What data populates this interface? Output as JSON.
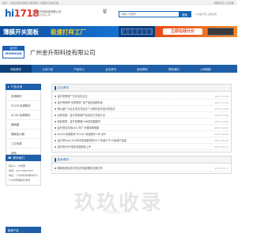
{
  "topbar": {
    "left": "您好，欢迎光临中国电子网商城 | 请登录 免费注册",
    "right": "收藏本站 | 手机版"
  },
  "logo": {
    "main": "hi",
    "accent": "1718"
  },
  "site": {
    "name": "广州金升阳科技有限公司",
    "subtitle": "找电源就到电子网"
  },
  "header_tag": "留",
  "search": {
    "placeholder": "请输入关键字",
    "button": "搜索"
  },
  "top_links": "广州金升阳  立即咨询",
  "banner": {
    "left_title": "薄膜开关面板",
    "left_highlight": "极速打样工厂",
    "cta": "立即在线计价"
  },
  "company": {
    "logo_top": "金升阳",
    "logo_bottom": "MORNSUN",
    "name": "广州金升阳科技有限公司"
  },
  "nav": [
    {
      "label": "网站首页",
      "active": true
    },
    {
      "label": "公司介绍",
      "active": false
    },
    {
      "label": "产品中心",
      "active": false
    },
    {
      "label": "企业资讯",
      "active": false
    },
    {
      "label": "技术资料",
      "active": false
    },
    {
      "label": "联系我们",
      "active": false
    },
    {
      "label": "公司相册",
      "active": false
    }
  ],
  "sidebar": {
    "title": "产品分类",
    "items": [
      "电源模块",
      "DC/DC电源模块",
      "AC/DC电源模块",
      "隔离器",
      "隔离放大器",
      "工业电源",
      "其他"
    ]
  },
  "contact": {
    "title": "联系我们",
    "lines": [
      "联系人：市场部",
      "电话：020-38601850",
      "地址：广州市科学城科学大道",
      "广州市黄埔区科学城"
    ]
  },
  "news": {
    "title": "企业资讯",
    "rows": [
      {
        "title": "金升阳荣获广东省名优企业",
        "date": "2017-11-16"
      },
      {
        "title": "金升阳荣获“优质服务”及产品优选服务奖",
        "date": "2017-11-14"
      },
      {
        "title": "第九届广州企业家交流会在广州顺利召开金升阳协办",
        "date": "2017-11-08"
      },
      {
        "title": "高铁电源：金升阳电源产品应用于高铁行业",
        "date": "2017-11-06"
      },
      {
        "title": "新品推荐：金升阳隔离CAN收发器模块",
        "date": "2017-11-02"
      },
      {
        "title": "金升阳将亮相2017年广州国际照明展",
        "date": "2017-10-31"
      },
      {
        "title": "DC/DC电源模块 DC/DC 电源模块 2W 系列",
        "date": "2017-10-25"
      },
      {
        "title": "金升阳Pro6-20D系列电源模块获2017年度TOP10电源产品奖",
        "date": "2017-10-16"
      },
      {
        "title": "金升阳IGBT驱动电源新品上市",
        "date": "2017-10-12"
      }
    ]
  },
  "tech": {
    "title": "技术资料",
    "rows": [
      {
        "title": "隔离电源应用中常见的电磁兼容问题分析",
        "date": "2017-11-17"
      }
    ]
  },
  "watermark": {
    "main": "玖玖收录",
    "sub": "9999SL.COM"
  },
  "footer_strip": "推荐产品"
}
